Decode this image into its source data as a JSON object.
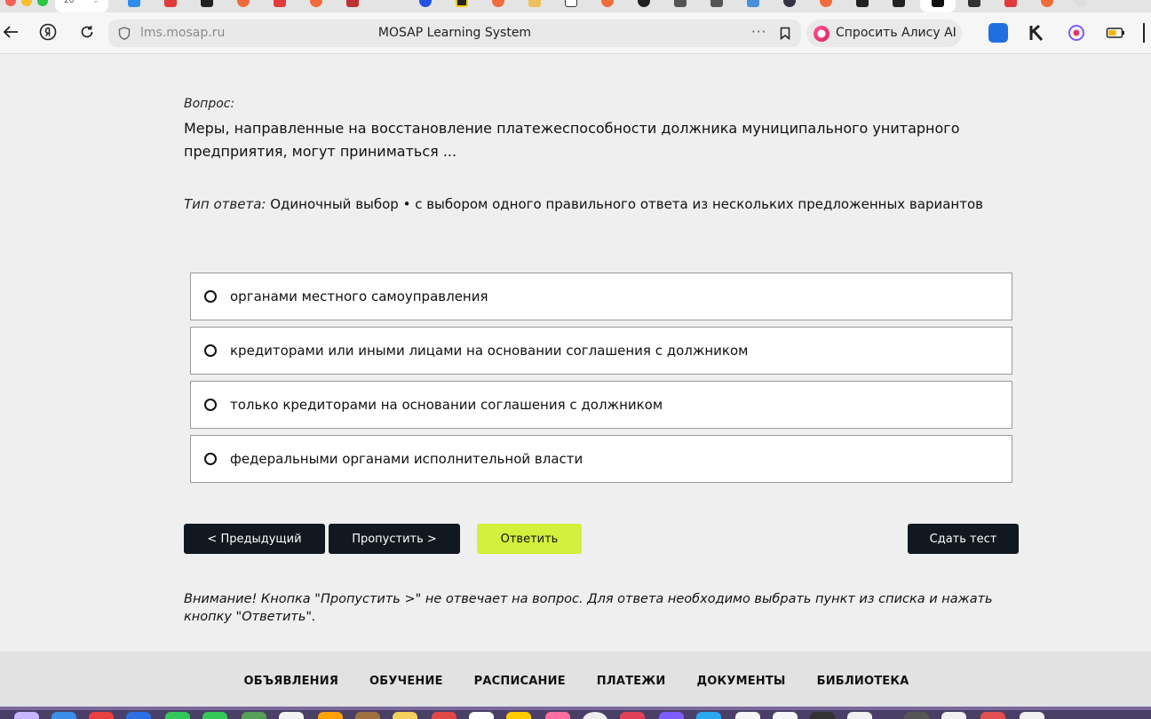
{
  "browser": {
    "active_tab_label": "20",
    "url": "lms.mosap.ru",
    "page_title": "MOSAP Learning System",
    "menu_dots": "···",
    "alice_button": "Спросить Алису AI"
  },
  "question": {
    "label": "Вопрос:",
    "text": "Меры, направленные на восстановление платежеспособности должника муниципального унитарного предприятия, могут приниматься ...",
    "answer_type_label": "Тип ответа:",
    "answer_type_value": "Одиночный выбор • с выбором одного правильного ответа из нескольких предложенных вариантов"
  },
  "options": [
    {
      "text": "органами местного самоуправления",
      "selected": false
    },
    {
      "text": "кредиторами или иными лицами на основании соглашения с должником",
      "selected": false
    },
    {
      "text": "только кредиторами на основании соглашения с должником",
      "selected": false
    },
    {
      "text": "федеральными органами исполнительной власти",
      "selected": false
    }
  ],
  "buttons": {
    "prev": "< Предыдущий",
    "skip": "Пропустить >",
    "answer": "Ответить",
    "finish": "Сдать тест"
  },
  "warning": "Внимание! Кнопка \"Пропустить >\" не отвечает на вопрос. Для ответа необходимо выбрать пункт из списка и нажать кнопку \"Ответить\".",
  "footer_nav": [
    "ОБЪЯВЛЕНИЯ",
    "ОБУЧЕНИЕ",
    "РАСПИСАНИЕ",
    "ПЛАТЕЖИ",
    "ДОКУМЕНТЫ",
    "БИБЛИОТЕКА"
  ],
  "colors": {
    "page_bg": "#efefef",
    "dark_button": "#12181f",
    "accent_lime": "#d2f03c",
    "footer_bg": "#e2e2e2"
  }
}
